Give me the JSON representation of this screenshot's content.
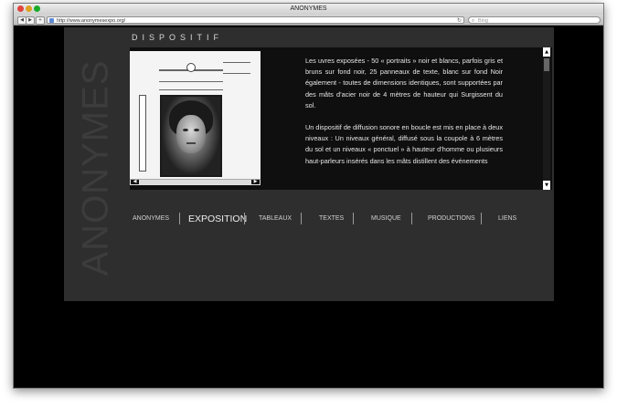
{
  "browser": {
    "window_title": "ANONYMES",
    "url": "http://www.anonymesexpo.org/",
    "search_placeholder": "Bing",
    "back_glyph": "◀",
    "forward_glyph": "▶",
    "add_glyph": "+",
    "reload_glyph": "↻",
    "search_glyph": "⌕"
  },
  "site": {
    "brand": "ANONYMES",
    "section_title": "DISPOSITIF"
  },
  "content": {
    "paragraphs": [
      "Les uvres exposées - 50 « portraits » noir et blancs, parfois gris et bruns sur fond noir, 25 panneaux de texte, blanc sur fond Noir également - toutes de dimensions identiques, sont supportées par des mâts d’acier noir de 4 mètres de hauteur qui Surgissent du sol.",
      "Un dispositif de diffusion sonore en boucle est mis en place à deux niveaux : Un niveaux général, diffusé sous la coupole à 6 mètres du sol et un niveaux « ponctuel » à hauteur d’homme ou plusieurs haut-parleurs insérés dans les mâts distillent des événements"
    ],
    "scroll_up_glyph": "▲",
    "scroll_down_glyph": "▼",
    "img_scroll_left_glyph": "◀",
    "img_scroll_right_glyph": "▶"
  },
  "nav": {
    "items": [
      {
        "label": "ANONYMES"
      },
      {
        "label": "EXPOSITION",
        "active": true
      },
      {
        "label": "TABLEAUX"
      },
      {
        "label": "TEXTES"
      },
      {
        "label": "MUSIQUE"
      },
      {
        "label": "PRODUCTIONS"
      },
      {
        "label": "LIENS"
      }
    ]
  },
  "colors": {
    "panel_bg": "#2e2e2e",
    "page_bg": "#000000",
    "text": "#e6e6e6"
  },
  "icons": [
    "back-arrow-icon",
    "forward-arrow-icon",
    "add-icon",
    "reload-icon",
    "search-icon",
    "scroll-up-icon",
    "scroll-down-icon"
  ]
}
